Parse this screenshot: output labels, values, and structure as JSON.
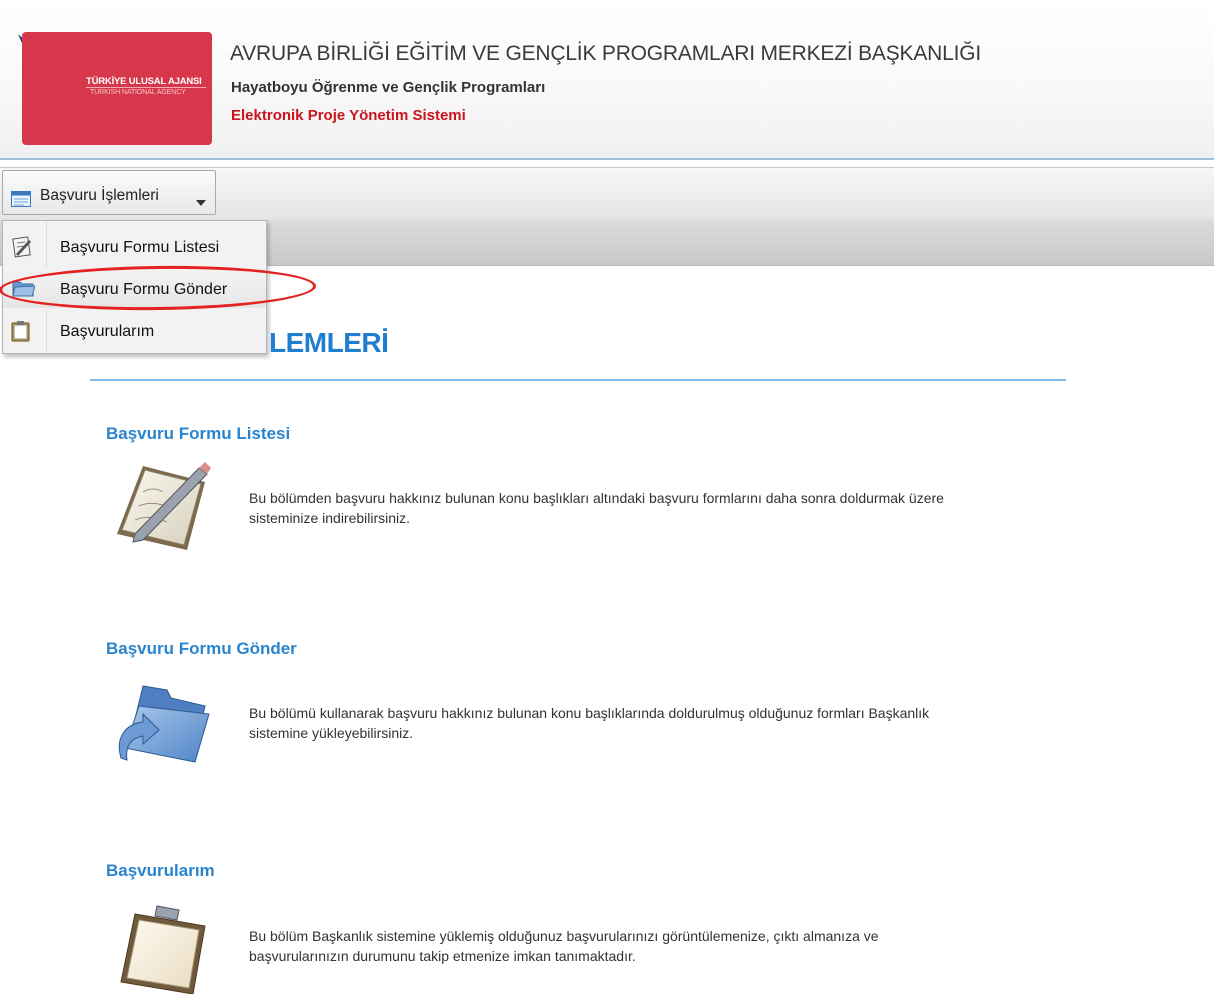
{
  "header": {
    "logo_title": "TÜRKİYE ULUSAL AJANSI",
    "logo_subtitle": "TURKISH NATIONAL AGENCY",
    "title": "AVRUPA BİRLİĞİ EĞİTİM VE GENÇLİK PROGRAMLARI MERKEZİ BAŞKANLIĞI",
    "subtitle": "Hayatboyu Öğrenme ve Gençlik Programları",
    "system_name": "Elektronik Proje Yönetim Sistemi"
  },
  "toolbar": {
    "menu_label": "Başvuru İşlemleri"
  },
  "dropdown": {
    "items": [
      {
        "label": "Başvuru Formu Listesi",
        "icon": "edit-form-icon"
      },
      {
        "label": "Başvuru Formu Gönder",
        "icon": "send-form-icon"
      },
      {
        "label": "Başvurularım",
        "icon": "clipboard-icon"
      }
    ]
  },
  "main": {
    "heading_visible": "LEMLERİ",
    "sections": [
      {
        "title": "Başvuru Formu Listesi",
        "description": "Bu bölümden başvuru hakkınız bulunan konu başlıkları altındaki başvuru formlarını daha sonra doldurmak üzere sisteminize indirebilirsiniz.",
        "icon": "document-pencil-icon"
      },
      {
        "title": "Başvuru Formu Gönder",
        "description": "Bu bölümü kullanarak başvuru hakkınız bulunan konu başlıklarında doldurulmuş olduğunuz formları Başkanlık sistemine yükleyebilirsiniz.",
        "icon": "folder-upload-icon"
      },
      {
        "title": "Başvurularım",
        "description": "Bu bölüm Başkanlık sistemine yüklemiş olduğunuz başvurularınızı görüntülemenize, çıktı almanıza ve başvurularınızın durumunu takip etmenize imkan tanımaktadır.",
        "icon": "clipboard-icon"
      }
    ]
  },
  "colors": {
    "brand_red": "#d6374a",
    "link_blue": "#2a85cf",
    "highlight_red": "#e52222"
  }
}
